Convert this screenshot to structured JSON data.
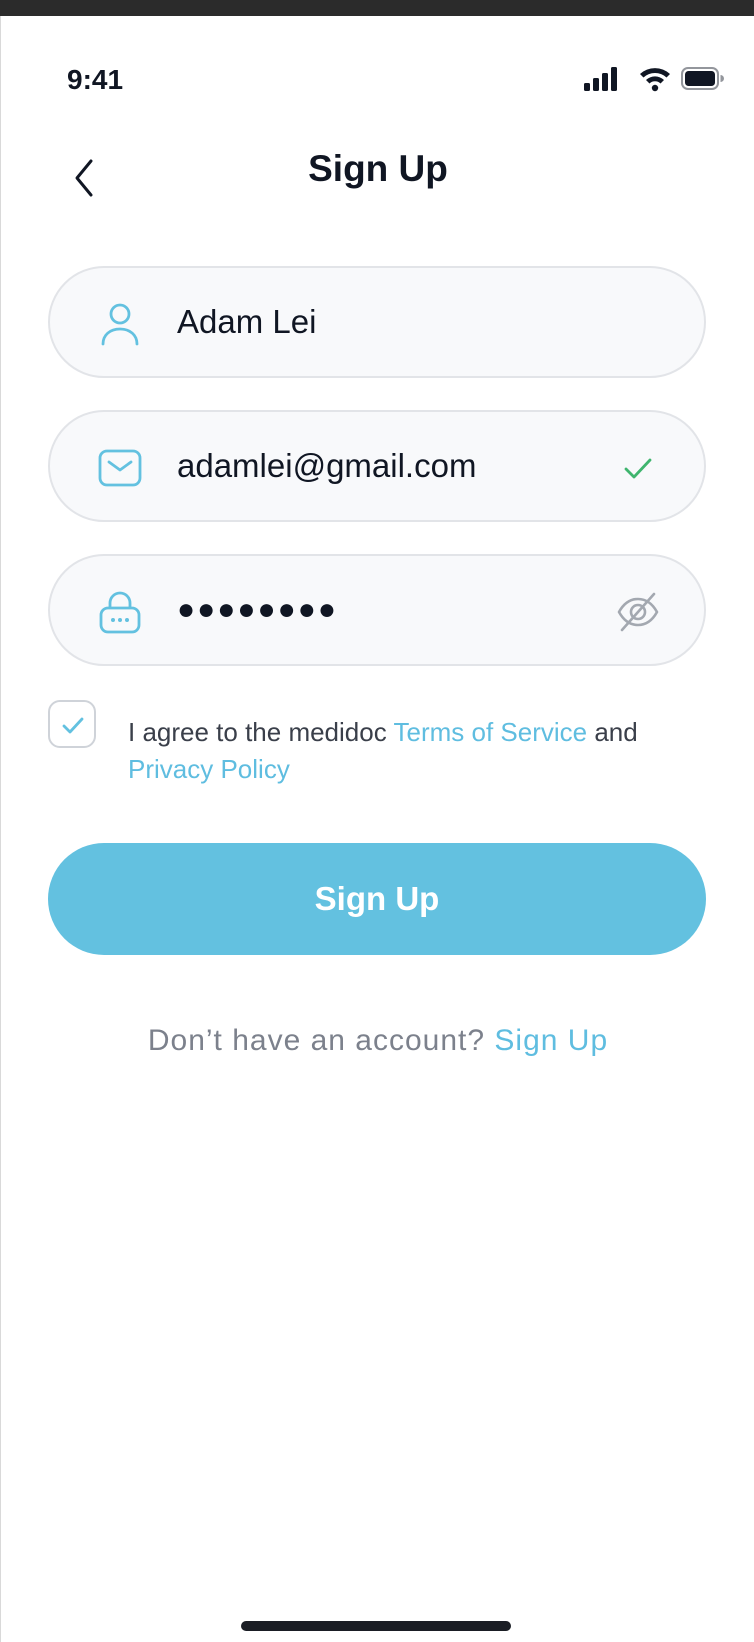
{
  "status_bar": {
    "time": "9:41"
  },
  "header": {
    "title": "Sign Up"
  },
  "form": {
    "name_value": "Adam Lei",
    "email_value": "adamlei@gmail.com",
    "password_mask": "●●●●●●●●",
    "email_valid": true
  },
  "agreement": {
    "checked": true,
    "prefix": "I agree to the medidoc ",
    "terms_link": "Terms of Service",
    "middle": " and",
    "privacy_link": "Privacy Policy"
  },
  "primary_button": {
    "label": "Sign Up"
  },
  "footer": {
    "question": "Don’t have an account? ",
    "link": "Sign Up"
  },
  "colors": {
    "accent": "#63c1e0",
    "link": "#5fbde0",
    "success": "#3fb56e",
    "text": "#101623"
  },
  "icons": {
    "back": "chevron-left-icon",
    "name": "user-icon",
    "email": "mail-icon",
    "email_status": "check-icon",
    "password": "lock-icon",
    "password_toggle": "eye-off-icon"
  }
}
